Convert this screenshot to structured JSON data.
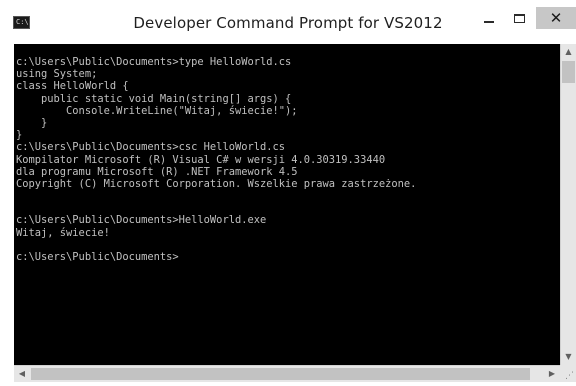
{
  "window": {
    "title": "Developer Command Prompt for VS2012",
    "icon": "console-icon",
    "icon_glyph": "C:\\",
    "controls": {
      "minimize_icon": "minimize-icon",
      "maximize_icon": "maximize-icon",
      "close_icon": "close-icon",
      "close_glyph": "✕"
    }
  },
  "console": {
    "background": "#000000",
    "foreground": "#c0c0c0",
    "lines": [
      "c:\\Users\\Public\\Documents>type HelloWorld.cs",
      "using System;",
      "class HelloWorld {",
      "    public static void Main(string[] args) {",
      "        Console.WriteLine(\"Witaj, świecie!\");",
      "    }",
      "}",
      "c:\\Users\\Public\\Documents>csc HelloWorld.cs",
      "Kompilator Microsoft (R) Visual C# w wersji 4.0.30319.33440",
      "dla programu Microsoft (R) .NET Framework 4.5",
      "Copyright (C) Microsoft Corporation. Wszelkie prawa zastrzeżone.",
      "",
      "",
      "c:\\Users\\Public\\Documents>HelloWorld.exe",
      "Witaj, świecie!",
      "",
      "c:\\Users\\Public\\Documents>"
    ]
  },
  "scrollbars": {
    "up_arrow": "▲",
    "down_arrow": "▼",
    "left_arrow": "◀",
    "right_arrow": "▶",
    "grip": "⋰"
  }
}
